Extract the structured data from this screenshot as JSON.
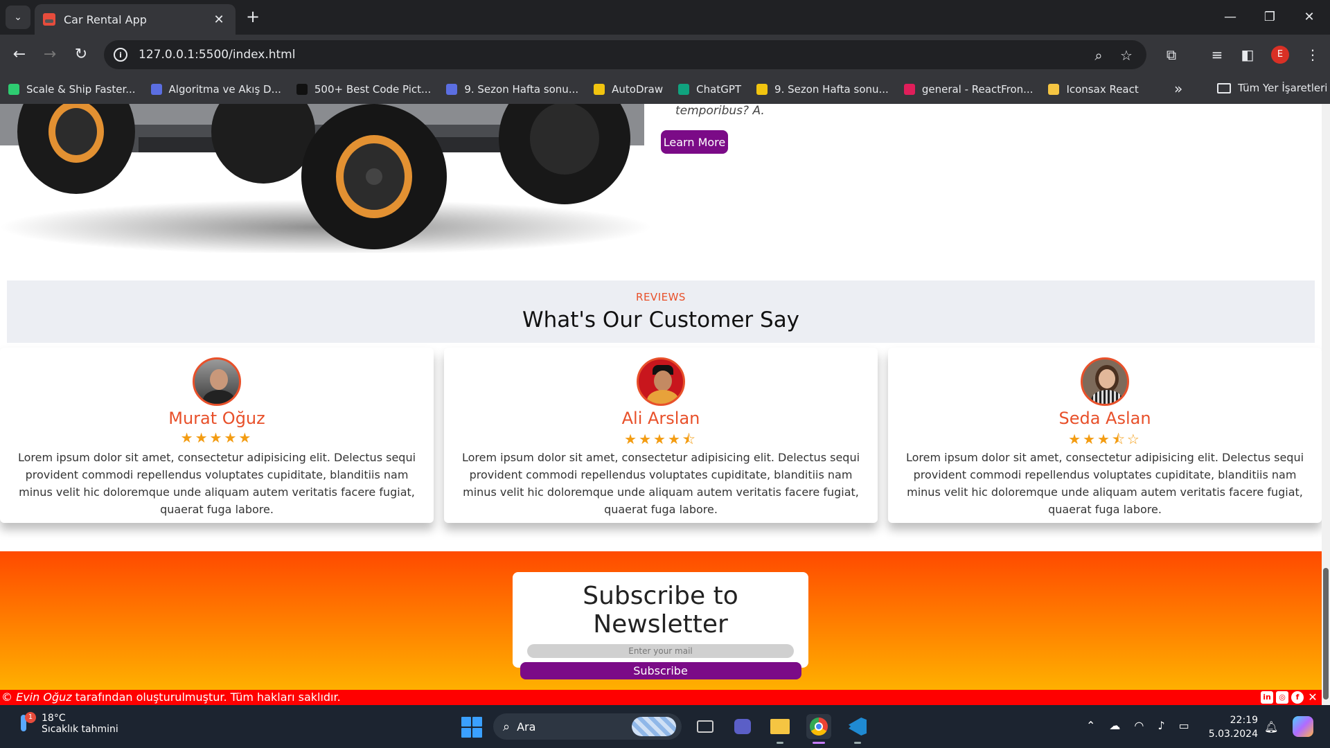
{
  "browser": {
    "tab_title": "Car Rental App",
    "url": "127.0.0.1:5500/index.html",
    "profile_initial": "E",
    "bookmarks": [
      {
        "label": "Scale & Ship Faster...",
        "color": "#2ecc71"
      },
      {
        "label": "Algoritma ve Akış D...",
        "color": "#5b6ee1"
      },
      {
        "label": "500+ Best Code Pict...",
        "color": "#111111"
      },
      {
        "label": "9. Sezon Hafta sonu...",
        "color": "#5b6ee1"
      },
      {
        "label": "AutoDraw",
        "color": "#f1c40f"
      },
      {
        "label": "ChatGPT",
        "color": "#10a37f"
      },
      {
        "label": "9. Sezon Hafta sonu...",
        "color": "#f1c40f"
      },
      {
        "label": "general - ReactFron...",
        "color": "#e01e5a"
      },
      {
        "label": "Iconsax React",
        "color": "#f5c542"
      }
    ],
    "all_bookmarks_label": "Tüm Yer İşaretleri"
  },
  "hero": {
    "text": "temporibus? A.",
    "learn_more": "Learn More"
  },
  "reviews": {
    "kicker": "REVIEWS",
    "title": "What's Our Customer Say",
    "cards": [
      {
        "name": "Murat Oğuz",
        "rating": 5,
        "stars": "★★★★★",
        "text": "Lorem ipsum dolor sit amet, consectetur adipisicing elit. Delectus sequi provident commodi repellendus voluptates cupiditate, blanditiis nam minus velit hic doloremque unde aliquam autem veritatis facere fugiat, quaerat fuga labore."
      },
      {
        "name": "Ali Arslan",
        "rating": 4.5,
        "stars": "★★★★⯪",
        "text": "Lorem ipsum dolor sit amet, consectetur adipisicing elit. Delectus sequi provident commodi repellendus voluptates cupiditate, blanditiis nam minus velit hic doloremque unde aliquam autem veritatis facere fugiat, quaerat fuga labore."
      },
      {
        "name": "Seda Aslan",
        "rating": 3.5,
        "stars": "★★★⯪☆",
        "text": "Lorem ipsum dolor sit amet, consectetur adipisicing elit. Delectus sequi provident commodi repellendus voluptates cupiditate, blanditiis nam minus velit hic doloremque unde aliquam autem veritatis facere fugiat, quaerat fuga labore."
      }
    ]
  },
  "newsletter": {
    "title": "Subscribe to Newsletter",
    "placeholder": "Enter your mail",
    "button": "Subscribe"
  },
  "footer": {
    "author": "Evin Oğuz",
    "text": " tarafından oluşturulmuştur. Tüm hakları saklıdır.",
    "copyright_symbol": "©"
  },
  "taskbar": {
    "temperature": "18°C",
    "weather_desc": "Sıcaklık tahmini",
    "weather_badge": "1",
    "search_label": "Ara",
    "time": "22:19",
    "date": "5.03.2024"
  },
  "colors": {
    "accent": "#e8502a",
    "button": "#7b0b87",
    "footer": "#ff0000"
  }
}
